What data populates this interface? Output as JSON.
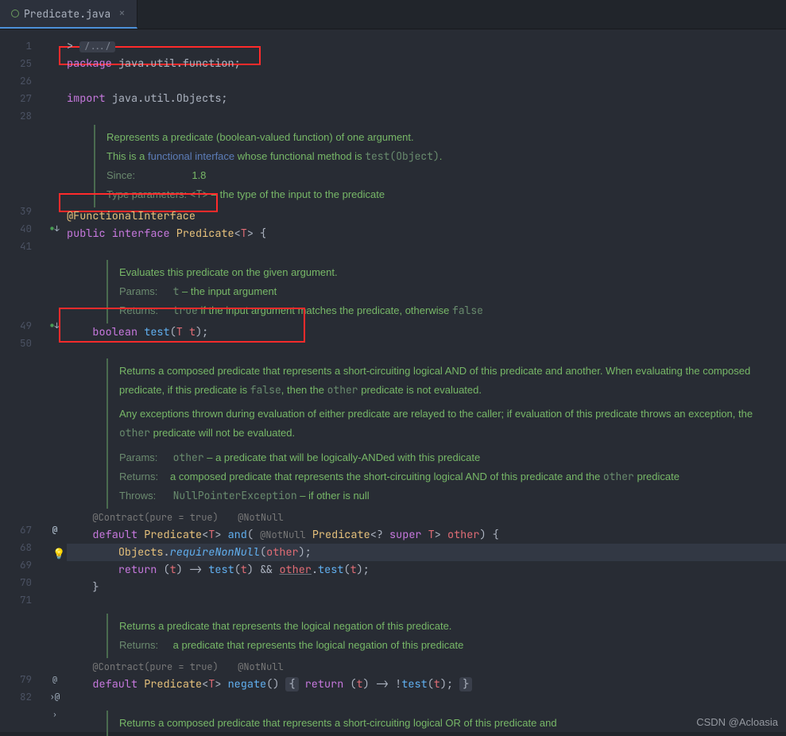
{
  "tab": {
    "filename": "Predicate.java"
  },
  "gutter_lines": [
    "1",
    "25",
    "26",
    "27",
    "28",
    "",
    "",
    "",
    "",
    "",
    "39",
    "40",
    "41",
    "",
    "",
    "",
    "",
    "49",
    "50",
    "",
    "",
    "",
    "",
    "",
    "",
    "",
    "",
    "",
    "",
    "",
    "67",
    "68",
    "69",
    "70",
    "71",
    "",
    "",
    "",
    "",
    "79",
    "82",
    "",
    "",
    ""
  ],
  "gutter_marks": {
    "11": "impl",
    "17": "impl",
    "30": "at",
    "39": "ov"
  },
  "code": {
    "fold": "/.../",
    "pkg_kw": "package",
    "pkg_name": "java.util.function",
    "imp_kw": "import",
    "imp_name": "java.util.Objects",
    "ann_functional": "@FunctionalInterface",
    "public": "public",
    "interface": "interface",
    "classname": "Predicate",
    "generic_T": "T",
    "boolean": "boolean",
    "test": "test",
    "t_param": "t",
    "contract_pure": "@Contract(pure = true)",
    "notnull": "@NotNull",
    "default": "default",
    "and": "and",
    "super": "super",
    "other": "other",
    "objects": "Objects",
    "requireNonNull": "requireNonNull",
    "return": "return",
    "arrow": "->",
    "and_op": "&&",
    "negate": "negate",
    "bang": "!"
  },
  "doc1": {
    "l1": "Represents a predicate (boolean-valued function) of one argument.",
    "l2a": "This is a ",
    "l2link": "functional interface",
    "l2b": " whose functional method is ",
    "l2code": "test(Object)",
    "l2c": ".",
    "since_label": "Since:",
    "since_val": "1.8",
    "tp_label": "Type parameters:",
    "tp_val_a": "<T>",
    "tp_val_b": " – the type of the input to the predicate"
  },
  "doc2": {
    "l1": "Evaluates this predicate on the given argument.",
    "param_label": "Params:",
    "param_val": "t – the input argument",
    "ret_label": "Returns:",
    "ret_a": "true",
    "ret_b": " if the input argument matches the predicate, otherwise ",
    "ret_c": "false"
  },
  "doc3": {
    "l1a": "Returns a composed predicate that represents a short-circuiting logical AND of this predicate and another. When evaluating the composed predicate, if this predicate is ",
    "l1b": "false",
    "l1c": ", then the ",
    "l1d": "other",
    "l1e": " predicate is not evaluated.",
    "l2a": "Any exceptions thrown during evaluation of either predicate are relayed to the caller; if evaluation of this predicate throws an exception, the ",
    "l2b": "other",
    "l2c": " predicate will not be evaluated.",
    "param_label": "Params:",
    "param_a": "other",
    "param_b": " – a predicate that will be logically-ANDed with this predicate",
    "ret_label": "Returns:",
    "ret_a": "a composed predicate that represents the short-circuiting logical AND of this predicate and the ",
    "ret_b": "other",
    "ret_c": " predicate",
    "throws_label": "Throws:",
    "throws_a": "NullPointerException",
    "throws_b": " – if other is null"
  },
  "doc4": {
    "l1": "Returns a predicate that represents the logical negation of this predicate.",
    "ret_label": "Returns:",
    "ret_val": "a predicate that represents the logical negation of this predicate"
  },
  "doc5": {
    "l1": "Returns a composed predicate that represents a short-circuiting logical OR of this predicate and"
  },
  "watermark": "CSDN @Acloasia"
}
